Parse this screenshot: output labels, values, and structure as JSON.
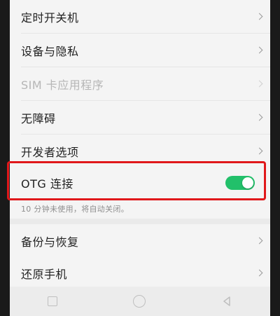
{
  "settings": {
    "items": [
      {
        "label": "定时开关机",
        "enabled": true
      },
      {
        "label": "设备与隐私",
        "enabled": true
      },
      {
        "label": "SIM 卡应用程序",
        "enabled": false
      },
      {
        "label": "无障碍",
        "enabled": true
      },
      {
        "label": "开发者选项",
        "enabled": true
      }
    ],
    "otg": {
      "label": "OTG 连接",
      "toggle_on": true,
      "description": "10 分钟未使用，将自动关闭。"
    },
    "items2": [
      {
        "label": "备份与恢复"
      },
      {
        "label": "还原手机"
      }
    ]
  },
  "colors": {
    "toggle_on": "#22c06a",
    "highlight_border": "#e0181b"
  },
  "icons": {
    "chevron": "chevron-right-icon",
    "nav_recent": "square-icon",
    "nav_home": "circle-icon",
    "nav_back": "triangle-back-icon"
  }
}
